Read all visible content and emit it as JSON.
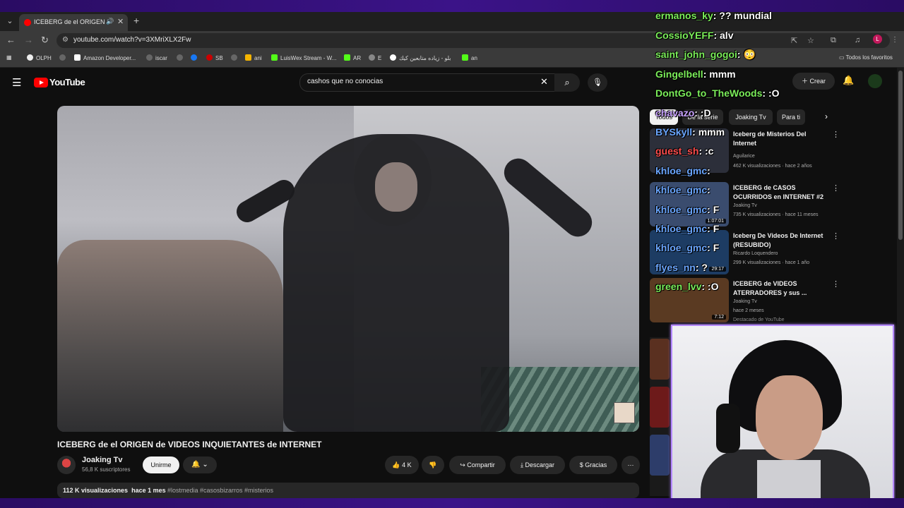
{
  "browser": {
    "tab_title": "ICEBERG de el ORIGEN de V",
    "url": "youtube.com/watch?v=3XMriXLX2Fw",
    "bookmarks": [
      "OLPH",
      "Amazon Developer...",
      "iscar",
      "",
      "",
      "SB",
      "ani",
      "LuisWex Stream - W...",
      "AR",
      "E",
      "بلو - زياده متابعين كيك",
      "an"
    ],
    "all_bookmarks": "Todos los favoritos"
  },
  "yt": {
    "logo": "YouTube",
    "search_value": "cashos que no conocias",
    "create": "Crear"
  },
  "video": {
    "title": "ICEBERG de el ORIGEN de VIDEOS INQUIETANTES de INTERNET",
    "channel": "Joaking Tv",
    "subs": "56,8 K suscriptores",
    "join": "Unirme",
    "likes": "4 K",
    "share": "Compartir",
    "download": "Descargar",
    "thanks": "Gracias",
    "views": "112 K visualizaciones",
    "age": "hace 1 mes",
    "tags": "#lostmedia #casosbizarros #misterios"
  },
  "chips": [
    "Todos",
    "De la serie",
    "Joaking Tv",
    "Para ti"
  ],
  "recs": [
    {
      "title": "Iceberg de Misterios Del Internet",
      "channel": "Aguilarice",
      "meta": "462 K visualizaciones · hace 2 años",
      "dur": "",
      "color": "#2c2f3a"
    },
    {
      "title": "ICEBERG de CASOS OCURRIDOS en INTERNET #2",
      "channel": "Joaking Tv",
      "meta": "735 K visualizaciones · hace 11 meses",
      "dur": "1:07:01",
      "color": "#3a4c6e"
    },
    {
      "title": "Iceberg De Videos De Internet (RESUBIDO)",
      "channel": "Ricardo Loquendero",
      "meta": "299 K visualizaciones · hace 1 año",
      "dur": "29:17",
      "color": "#1d3c63"
    },
    {
      "title": "ICEBERG de VIDEOS ATERRADORES y sus ...",
      "channel": "Joaking Tv",
      "meta": "hace 2 meses",
      "dur": "7:12",
      "color": "#5a3a22"
    }
  ],
  "rec_badge": "Destacado de YouTube",
  "chat": [
    {
      "user": "ermanos_ky",
      "text": ": ?? mundial"
    },
    {
      "user": "CossioYEFF",
      "text": ": alv"
    },
    {
      "user": "saint_john_gogoi",
      "text": ": 😳"
    },
    {
      "user": "Gingelbell",
      "text": ": mmm"
    },
    {
      "user": "DontGo_to_TheWoods",
      "text": ": :O"
    },
    {
      "user": "chavazo",
      "text": ": :D"
    },
    {
      "user": "BYSkyll",
      "text": ": mmm"
    },
    {
      "user": "guest_sh",
      "text": ": :c"
    },
    {
      "user": "khloe_gmc",
      "text": ": "
    },
    {
      "user": "khloe_gmc",
      "text": ": "
    },
    {
      "user": "khloe_gmc",
      "text": ": F"
    },
    {
      "user": "khloe_gmc",
      "text": ": F"
    },
    {
      "user": "khloe_gmc",
      "text": ": F"
    },
    {
      "user": "flyes_nn",
      "text": ": ?"
    },
    {
      "user": "green_lvv",
      "text": ": :O"
    }
  ]
}
